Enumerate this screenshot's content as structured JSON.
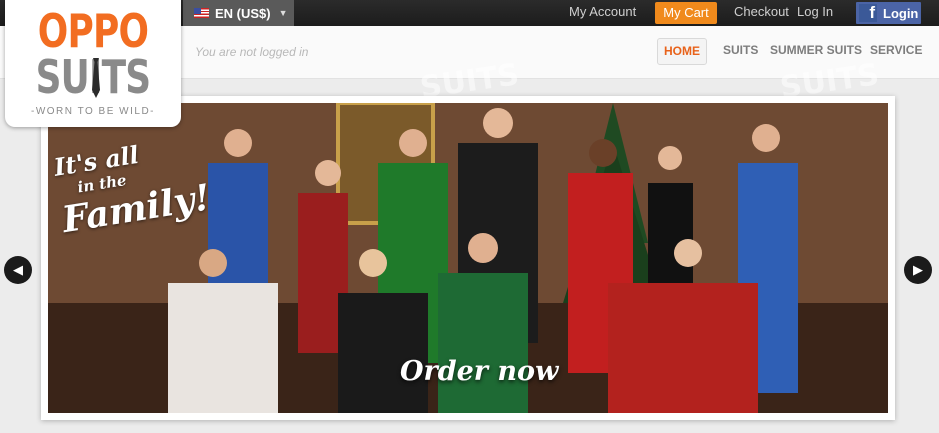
{
  "topbar": {
    "language": "EN (US$)",
    "my_account": "My Account",
    "my_cart": "My Cart",
    "checkout": "Checkout",
    "log_in": "Log In",
    "facebook_login": "Login"
  },
  "header": {
    "status": "You are not logged in",
    "nav": [
      "HOME",
      "SUITS",
      "SUMMER SUITS",
      "SERVICE"
    ]
  },
  "logo": {
    "line1": "OPPO",
    "line2": "SUITS",
    "tagline": "-WORN TO BE WILD-"
  },
  "banner": {
    "line1": "It's all",
    "line2": "in the",
    "line3": "Family!",
    "cta": "Order now"
  },
  "colors": {
    "accent": "#f26d21",
    "cart": "#f08a1c",
    "facebook": "#4b64a6",
    "topbar": "#1f1f1f"
  }
}
